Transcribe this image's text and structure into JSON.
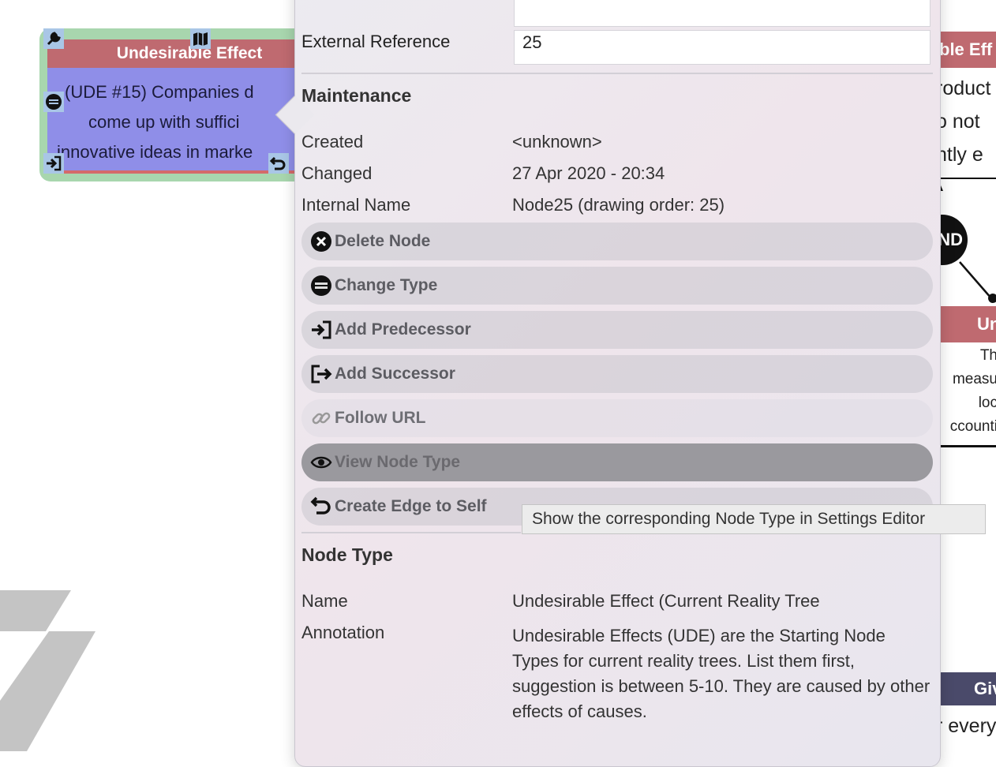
{
  "canvas": {
    "left_node": {
      "header": "Undesirable Effect",
      "lines": [
        "(UDE #15) Companies d",
        "come up with suffici",
        "innovative ideas in marke"
      ]
    },
    "right_top_header": "ble Eff",
    "right_top_lines": [
      "roduct",
      "o not",
      "ntly e"
    ],
    "and_label": "ND",
    "right_node2_header": "Un",
    "right_node2_lines": [
      "Th",
      "measu",
      "loc",
      "ccounti"
    ],
    "right_node3_header": "Giv",
    "right_node3_text": "r every"
  },
  "popover": {
    "external_reference_label": "External Reference",
    "external_reference_value": "25",
    "maintenance_title": "Maintenance",
    "created_label": "Created",
    "created_value": "<unknown>",
    "changed_label": "Changed",
    "changed_value": "27 Apr 2020 - 20:34",
    "internal_name_label": "Internal Name",
    "internal_name_value": "Node25 (drawing order: 25)",
    "actions": [
      {
        "label": "Delete Node",
        "icon": "x-circle-icon"
      },
      {
        "label": "Change Type",
        "icon": "change-type-icon"
      },
      {
        "label": "Add Predecessor",
        "icon": "add-predecessor-icon"
      },
      {
        "label": "Add Successor",
        "icon": "add-successor-icon"
      },
      {
        "label": "Follow URL",
        "icon": "link-icon"
      },
      {
        "label": "View Node Type",
        "icon": "eye-icon"
      },
      {
        "label": "Create Edge to Self",
        "icon": "undo-arrow-icon"
      }
    ],
    "tooltip": "Show the corresponding Node Type in Settings Editor",
    "node_type_title": "Node Type",
    "name_label": "Name",
    "name_value": "Undesirable Effect (Current Reality Tree",
    "annotation_label": "Annotation",
    "annotation_value": "Undesirable Effects (UDE) are the Starting Node Types for current reality trees. List them first, suggestion is between 5-10. They are caused by other effects of causes."
  },
  "colors": {
    "node_header": "#bf6a70",
    "node_body": "#8f8ee8",
    "node_border": "#a8d6ae",
    "active_action": "#9a999e"
  }
}
